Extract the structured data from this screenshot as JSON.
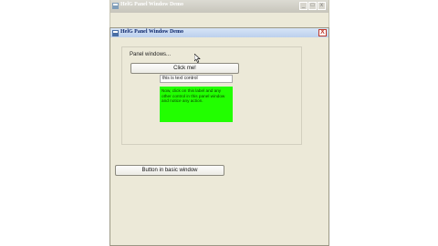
{
  "background_window": {
    "title": "HelG Panel Window Demo",
    "controls": [
      "_",
      "□",
      "x"
    ]
  },
  "window": {
    "title": "HelG Panel Window Demo",
    "close_label": "X"
  },
  "panel": {
    "label": "Panel windows..."
  },
  "buttons": {
    "click_me": "Click me!",
    "basic_window": "Button in basic window"
  },
  "text_control": {
    "value": "this is text control"
  },
  "note": {
    "text": "Now, click on this label and any other control in this panel window and notice any action."
  },
  "colors": {
    "note_bg": "#22ff00",
    "window_bg": "#ece9d8"
  },
  "icons": [
    "app-icon",
    "minimize-icon",
    "maximize-icon",
    "close-icon",
    "mouse-cursor-icon"
  ]
}
